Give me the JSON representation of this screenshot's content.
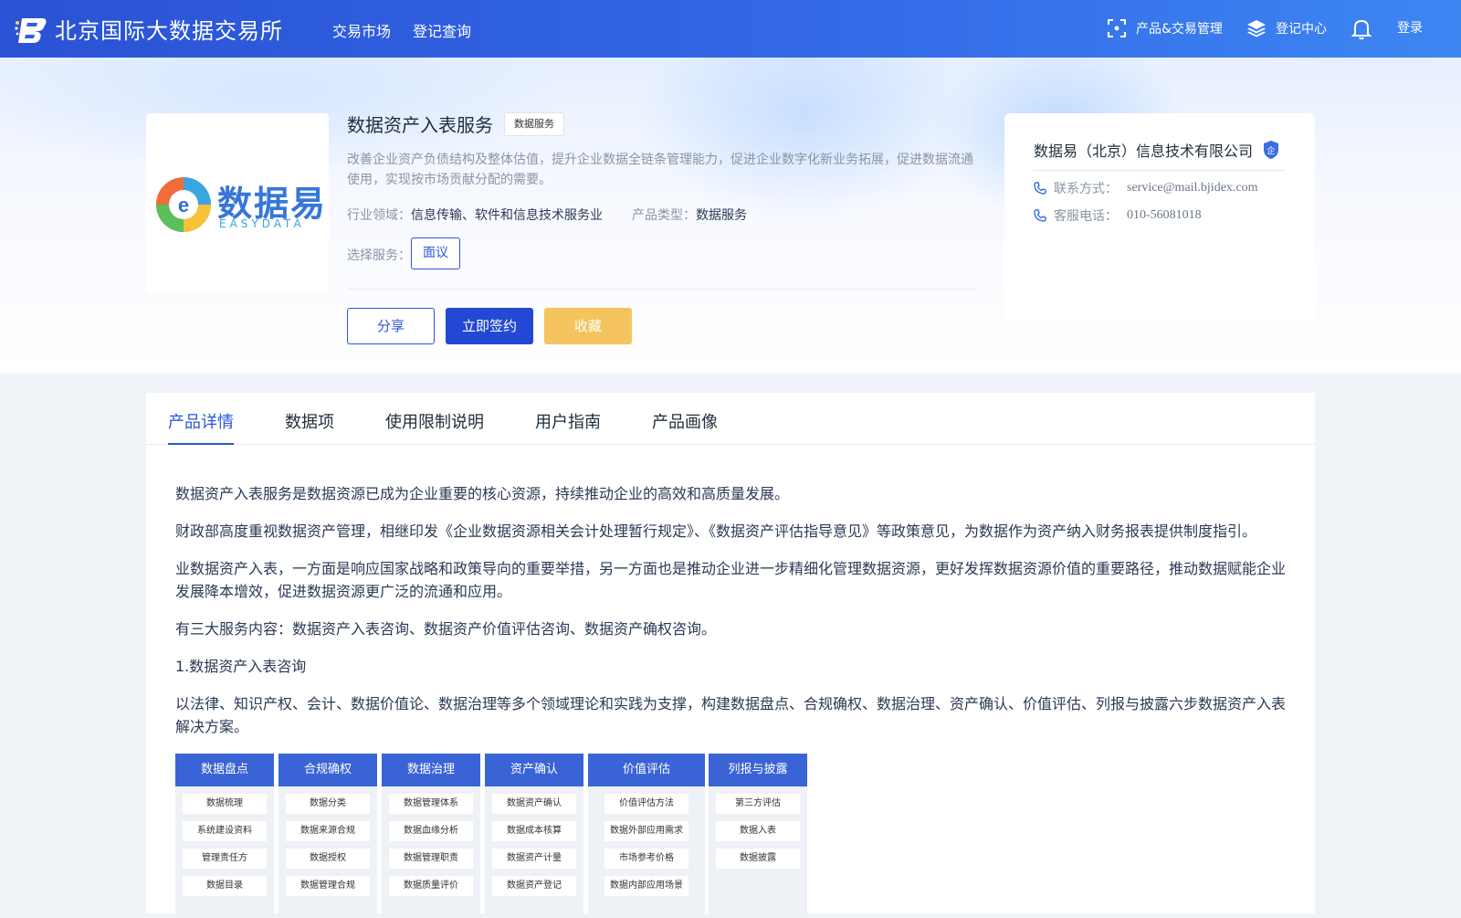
{
  "header": {
    "site_title": "北京国际大数据交易所",
    "nav": [
      "交易市场",
      "登记查询"
    ],
    "right": {
      "product_mgmt": "产品&交易管理",
      "registry": "登记中心",
      "login": "登录"
    }
  },
  "product": {
    "logo_text": "数据易",
    "logo_subtext": "EASYDATA",
    "name": "数据资产入表服务",
    "tag": "数据服务",
    "description": "改善企业资产负债结构及整体估值，提升企业数据全链条管理能力，促进企业数字化新业务拓展，促进数据流通使用，实现按市场贡献分配的需要。",
    "industry_label": "行业领域：",
    "industry_value": "信息传输、软件和信息技术服务业",
    "type_label": "产品类型：",
    "type_value": "数据服务",
    "service_label": "选择服务：",
    "service_option": "面议",
    "buttons": {
      "share": "分享",
      "sign": "立即签约",
      "favorite": "收藏"
    }
  },
  "company": {
    "name": "数据易（北京）信息技术有限公司",
    "badge": "企",
    "contact_label": "联系方式：",
    "contact_value": "service@mail.bjidex.com",
    "phone_label": "客服电话：",
    "phone_value": "010-56081018"
  },
  "tabs": [
    "产品详情",
    "数据项",
    "使用限制说明",
    "用户指南",
    "产品画像"
  ],
  "active_tab": 0,
  "detail": {
    "paragraphs": [
      "数据资产入表服务是数据资源已成为企业重要的核心资源，持续推动企业的高效和高质量发展。",
      "财政部高度重视数据资产管理，相继印发《企业数据资源相关会计处理暂行规定》、《数据资产评估指导意见》等政策意见，为数据作为资产纳入财务报表提供制度指引。",
      "业数据资产入表，一方面是响应国家战略和政策导向的重要举措，另一方面也是推动企业进一步精细化管理数据资源，更好发挥数据资源价值的重要路径，推动数据赋能企业发展降本增效，促进数据资源更广泛的流通和应用。",
      "有三大服务内容：数据资产入表咨询、数据资产价值评估咨询、数据资产确权咨询。",
      "1.数据资产入表咨询",
      "以法律、知识产权、会计、数据价值论、数据治理等多个领域理论和实践为支撑，构建数据盘点、合规确权、数据治理、资产确认、价值评估、列报与披露六步数据资产入表解决方案。"
    ],
    "steps": [
      {
        "title": "数据盘点",
        "items": [
          "数据梳理",
          "系统建设资料",
          "管理责任方",
          "数据目录"
        ]
      },
      {
        "title": "合规确权",
        "items": [
          "数据分类",
          "数据来源合规",
          "数据授权",
          "数据管理合规"
        ]
      },
      {
        "title": "数据治理",
        "items": [
          "数据管理体系",
          "数据血缘分析",
          "数据管理职责",
          "数据质量评价"
        ]
      },
      {
        "title": "资产确认",
        "items": [
          "数据资产确认",
          "数据成本核算",
          "数据资产计量",
          "数据资产登记"
        ]
      },
      {
        "title": "价值评估",
        "items": [
          "价值评估方法",
          "数据外部应用需求",
          "市场参考价格",
          "数据内部应用场景"
        ]
      },
      {
        "title": "列报与披露",
        "items": [
          "第三方评估",
          "数据入表",
          "数据披露"
        ]
      }
    ]
  }
}
